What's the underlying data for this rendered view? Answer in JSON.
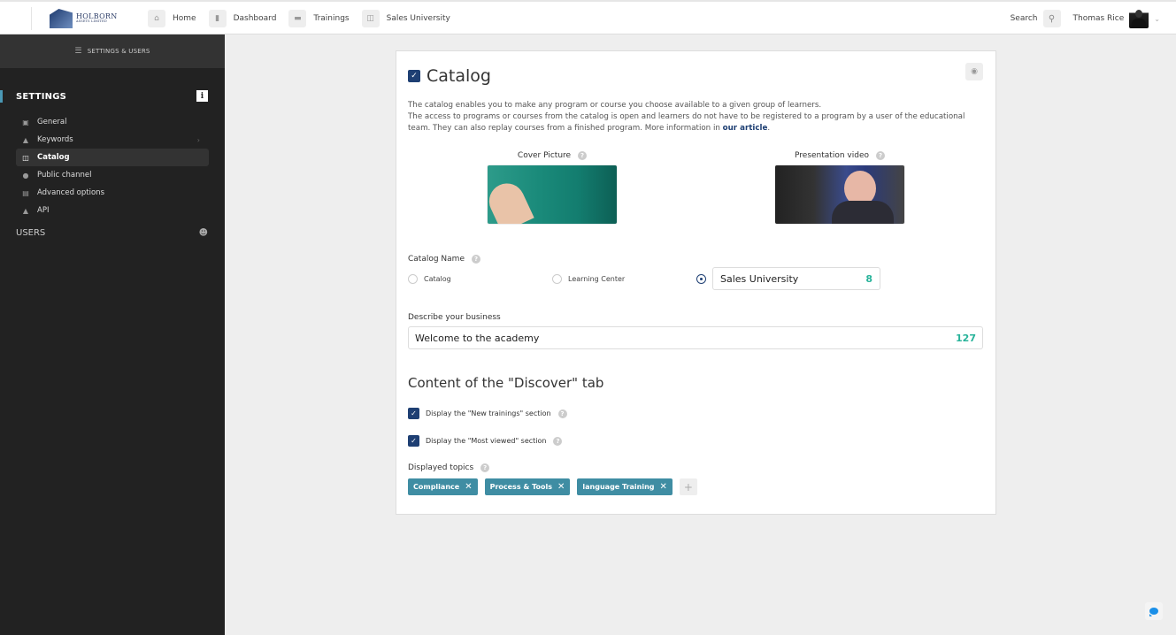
{
  "brand": {
    "name": "HOLBORN",
    "subtitle": "ASSETS LIMITED"
  },
  "topnav": {
    "items": [
      {
        "label": "Home",
        "icon": "home-icon"
      },
      {
        "label": "Dashboard",
        "icon": "bar-chart-icon"
      },
      {
        "label": "Trainings",
        "icon": "folder-icon"
      },
      {
        "label": "Sales University",
        "icon": "book-icon"
      }
    ],
    "search_label": "Search",
    "user_name": "Thomas Rice"
  },
  "sidebar": {
    "header": "SETTINGS & USERS",
    "settings_title": "SETTINGS",
    "items": [
      {
        "label": "General",
        "icon": "image-icon"
      },
      {
        "label": "Keywords",
        "icon": "tags-icon"
      },
      {
        "label": "Catalog",
        "icon": "book-icon",
        "active": true
      },
      {
        "label": "Public channel",
        "icon": "globe-icon"
      },
      {
        "label": "Advanced options",
        "icon": "options-icon"
      },
      {
        "label": "API",
        "icon": "api-icon"
      }
    ],
    "users_title": "USERS"
  },
  "catalog": {
    "title": "Catalog",
    "enabled": true,
    "description_line1": "The catalog enables you to make any program or course you choose available to a given group of learners.",
    "description_line2": "The access to programs or courses from the catalog is open and learners do not have to be registered to a program by a user of the educational team. They can also replay courses from a finished program. More information in ",
    "description_link": "our article",
    "description_end": ".",
    "cover_label": "Cover Picture",
    "video_label": "Presentation video",
    "name_label": "Catalog Name",
    "name_options": [
      "Catalog",
      "Learning Center"
    ],
    "name_custom_value": "Sales University",
    "name_custom_count": "8",
    "business_label": "Describe your business",
    "business_value": "Welcome to the  academy",
    "business_count": "127",
    "discover_title": "Content of the \"Discover\" tab",
    "checks": [
      {
        "label": "Display the \"New trainings\" section",
        "checked": true
      },
      {
        "label": "Display the \"Most viewed\" section",
        "checked": true
      }
    ],
    "topics_label": "Displayed topics",
    "topics": [
      "Compliance",
      "Process & Tools",
      "language Training"
    ]
  },
  "colors": {
    "accent": "#1e3f73",
    "tag": "#3f8da3",
    "counter": "#28b39a",
    "sidebar": "#222222"
  }
}
